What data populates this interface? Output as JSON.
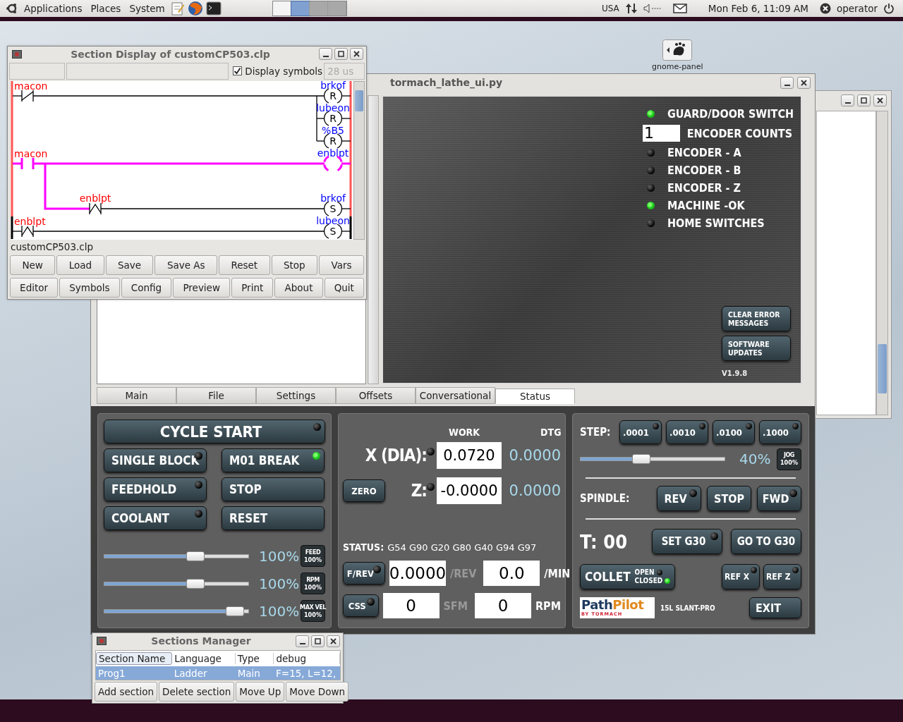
{
  "top_panel": {
    "menus": [
      "Applications",
      "Places",
      "System"
    ],
    "workspaces": [
      {
        "selected": false
      },
      {
        "selected": true
      },
      {
        "selected": false
      },
      {
        "selected": false
      }
    ],
    "keyboard_layout": "USA",
    "clock": "Mon Feb  6, 11:09 AM",
    "user": "operator"
  },
  "desktop": {
    "launcher_label": "gnome-panel"
  },
  "section_display": {
    "title": "Section Display of customCP503.clp",
    "display_symbols": {
      "label": "Display symbols",
      "checked": true
    },
    "scan_time": "28 us",
    "rungs": [
      {
        "highlighted": true,
        "energized": false,
        "contacts": [
          {
            "name": "macon",
            "kind": "closed"
          }
        ],
        "coils": [
          {
            "name": "brkof",
            "letter": "R"
          },
          {
            "name": "lubeon",
            "letter": "R"
          },
          {
            "name": "%B5",
            "letter": "R"
          }
        ]
      },
      {
        "highlighted": true,
        "energized": true,
        "contacts": [
          {
            "name": "macon",
            "kind": "open"
          }
        ],
        "coils": [
          {
            "name": "enblpt"
          }
        ],
        "branch": {
          "energized": false,
          "contact": {
            "name": "enblpt",
            "kind": "edge"
          },
          "coil": {
            "name": "brkof",
            "letter": "S"
          }
        }
      },
      {
        "highlighted": false,
        "energized": false,
        "contacts": [
          {
            "name": "enblpt",
            "kind": "edge"
          }
        ],
        "coils": [
          {
            "name": "lubeon",
            "letter": "S"
          }
        ]
      }
    ],
    "file_name": "customCP503.clp",
    "button_rows": [
      [
        "New",
        "Load",
        "Save",
        "Save As",
        "Reset",
        "Stop",
        "Vars"
      ],
      [
        "Editor",
        "Symbols",
        "Config",
        "Preview",
        "Print",
        "About",
        "Quit"
      ]
    ]
  },
  "tormach": {
    "title": "tormach_lathe_ui.py",
    "status_items": [
      {
        "kind": "led",
        "label": "GUARD/DOOR SWITCH",
        "on": true
      },
      {
        "kind": "counter",
        "value": "1",
        "label": "ENCODER COUNTS"
      },
      {
        "kind": "led",
        "label": "ENCODER - A",
        "on": false
      },
      {
        "kind": "led",
        "label": "ENCODER - B",
        "on": false
      },
      {
        "kind": "led",
        "label": "ENCODER - Z",
        "on": false
      },
      {
        "kind": "led",
        "label": "MACHINE -OK",
        "on": true
      },
      {
        "kind": "led",
        "label": "HOME SWITCHES",
        "on": false
      }
    ],
    "status_buttons": [
      "CLEAR ERROR\nMESSAGES",
      "SOFTWARE\nUPDATES"
    ],
    "version": "V1.9.8",
    "tabs": [
      {
        "label": "Main",
        "selected": false
      },
      {
        "label": "File",
        "selected": false
      },
      {
        "label": "Settings",
        "selected": false
      },
      {
        "label": "Offsets",
        "selected": false
      },
      {
        "label": "Conversational",
        "selected": false
      },
      {
        "label": "Status",
        "selected": true
      }
    ],
    "cycle_start": {
      "label": "CYCLE START",
      "led_on": false
    },
    "program_buttons": [
      {
        "label": "SINGLE BLOCK",
        "led_on": false
      },
      {
        "label": "M01 BREAK",
        "led_on": true
      },
      {
        "label": "FEEDHOLD",
        "led_on": false
      },
      {
        "label": "STOP"
      },
      {
        "label": "COOLANT",
        "led_on": false
      },
      {
        "label": "RESET"
      }
    ],
    "overrides": [
      {
        "level": 0.65,
        "reading": "100%",
        "badge_title": "FEED",
        "badge_value": "100%"
      },
      {
        "level": 0.65,
        "reading": "100%",
        "badge_title": "RPM",
        "badge_value": "100%"
      },
      {
        "level": 0.96,
        "reading": "100%",
        "badge_title": "MAX VEL",
        "badge_value": "100%"
      }
    ],
    "dro": {
      "headers": [
        "WORK",
        "DTG"
      ],
      "axes": [
        {
          "label": "X (DIA):",
          "led_on": false,
          "work": "0.0720",
          "dtg": "0.0000"
        },
        {
          "label": "Z:",
          "button": "ZERO",
          "led_on": false,
          "work": "-0.0000",
          "dtg": "0.0000"
        }
      ]
    },
    "status_line": {
      "label": "STATUS:",
      "codes": "G54 G90 G20 G80 G40 G94 G97"
    },
    "feed_rows": [
      {
        "button": "F/REV",
        "led_on": false,
        "value1": "0.0000",
        "unit1": "/REV",
        "unit1_active": false,
        "value2": "0.0",
        "unit2": "/MIN",
        "unit2_active": true
      },
      {
        "button": "CSS",
        "led_on": false,
        "value1": "0",
        "unit1": "SFM",
        "unit1_active": false,
        "value2": "0",
        "unit2": "RPM",
        "unit2_active": true
      }
    ],
    "jog": {
      "step_label": "STEP:",
      "steps": [
        {
          "label": ".0001",
          "led_on": false
        },
        {
          "label": ".0010",
          "led_on": false
        },
        {
          "label": ".0100",
          "led_on": false
        },
        {
          "label": ".1000",
          "led_on": false
        }
      ],
      "level": 0.41,
      "reading": "40%",
      "badge_title": "JOG",
      "badge_value": "100%"
    },
    "spindle": {
      "label": "SPINDLE:",
      "buttons": [
        {
          "label": "REV",
          "led_on": false
        },
        {
          "label": "STOP"
        },
        {
          "label": "FWD",
          "led_on": false
        }
      ]
    },
    "tool": "T: 00",
    "g30_buttons": [
      {
        "label": "SET G30",
        "led_on": false
      },
      {
        "label": "GO TO G30"
      }
    ],
    "collet": {
      "label": "COLLET",
      "states": [
        {
          "label": "OPEN",
          "on": false
        },
        {
          "label": "CLOSED",
          "on": true
        }
      ]
    },
    "ref_buttons": [
      {
        "label": "REF X",
        "led_on": false
      },
      {
        "label": "REF Z",
        "led_on": false
      }
    ],
    "logo": {
      "part1": "Path",
      "part2": "Pilot",
      "tagline": "BY TORMACH"
    },
    "model": "15L SLANT-PRO",
    "exit": "EXIT"
  },
  "sections_manager": {
    "title": "Sections Manager",
    "columns": [
      "Section Name",
      "Language",
      "Type",
      "debug"
    ],
    "rows": [
      {
        "cells": [
          "Prog1",
          "Ladder",
          "Main",
          "F=15, L=12,"
        ],
        "selected": true
      }
    ],
    "buttons": [
      "Add section",
      "Delete section",
      "Move Up",
      "Move Down"
    ]
  }
}
